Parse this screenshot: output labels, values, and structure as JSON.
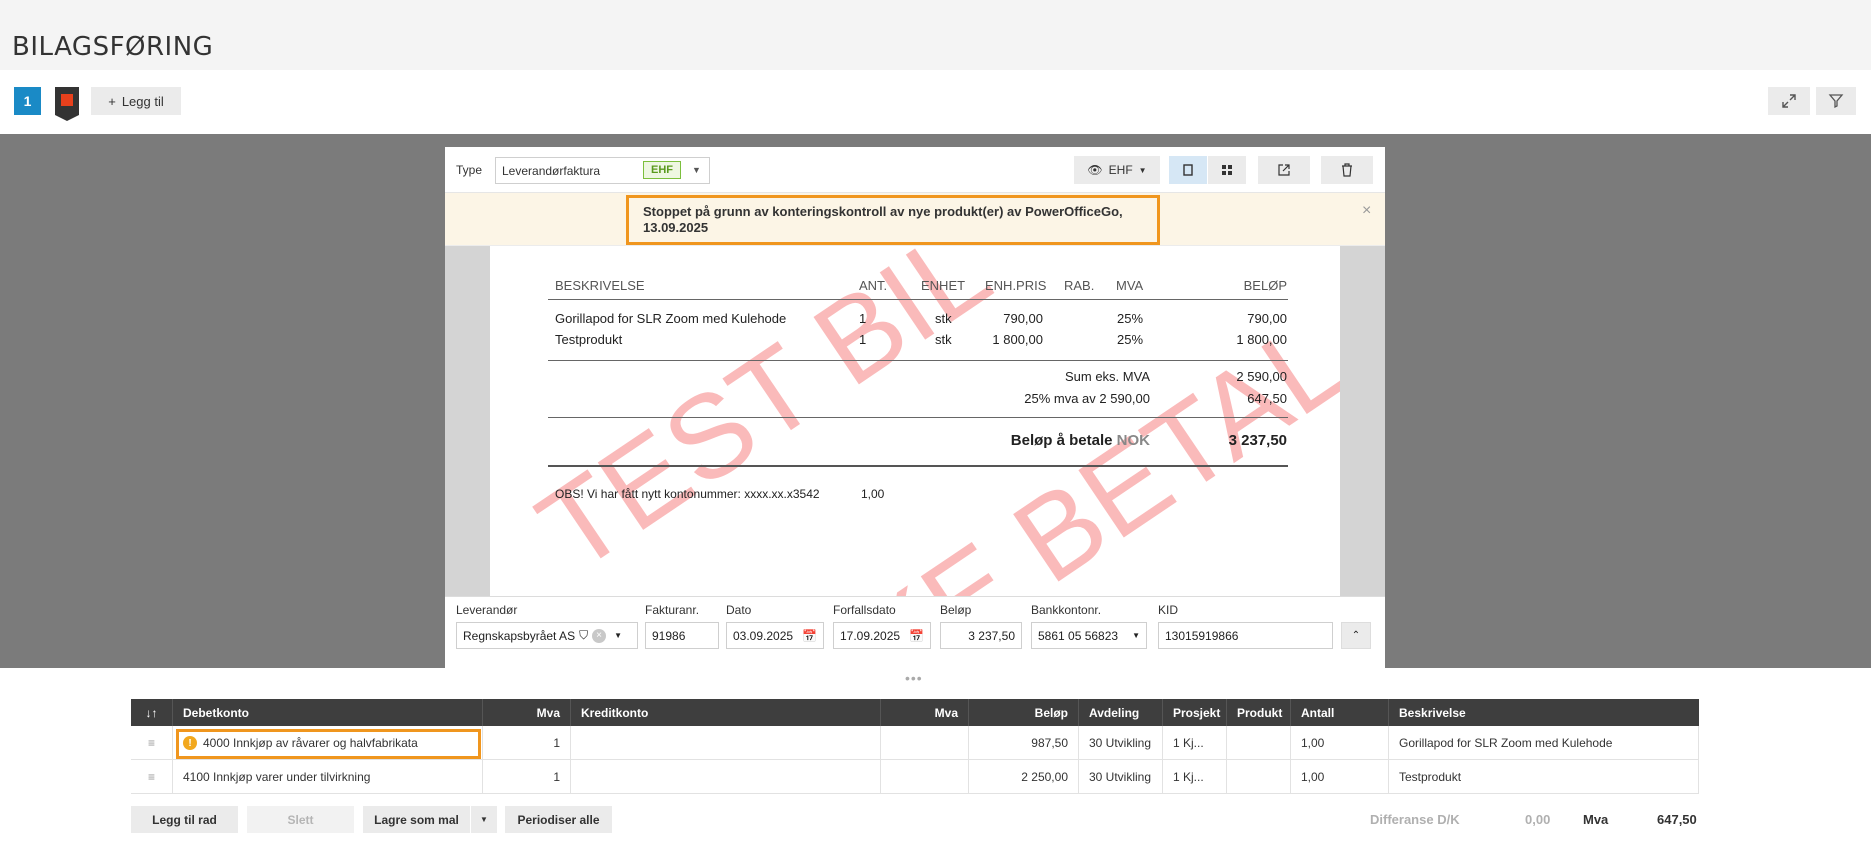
{
  "page": {
    "title": "BILAGSFØRING"
  },
  "toolbar": {
    "tab_number": "1",
    "add_label": "Legg til"
  },
  "document": {
    "type_label": "Type",
    "type_value": "Leverandørfaktura",
    "format_badge": "EHF",
    "view_format": "EHF",
    "notice": "Stoppet på grunn av konteringskontroll av nye produkt(er) av PowerOfficeGo, 13.09.2025",
    "notice_close": "×",
    "watermark_1": "TEST BIL",
    "watermark_2": "IKKE BETAL"
  },
  "invoice": {
    "headers": {
      "desc": "BESKRIVELSE",
      "qty": "ANT.",
      "unit": "ENHET",
      "price": "ENH.PRIS",
      "disc": "RAB.",
      "vat": "MVA",
      "amount": "BELØP"
    },
    "lines": [
      {
        "desc": "Gorillapod for SLR Zoom med Kulehode",
        "qty": "1",
        "unit": "stk",
        "price": "790,00",
        "vat": "25%",
        "amount": "790,00"
      },
      {
        "desc": "Testprodukt",
        "qty": "1",
        "unit": "stk",
        "price": "1 800,00",
        "vat": "25%",
        "amount": "1 800,00"
      }
    ],
    "sum_label": "Sum eks. MVA",
    "sum_value": "2 590,00",
    "vat_label": "25% mva av 2 590,00",
    "vat_value": "647,50",
    "total_label": "Beløp å betale",
    "total_currency": "NOK",
    "total_value": "3 237,50",
    "obs_text": "OBS! Vi har fått nytt kontonummer: xxxx.xx.x3542",
    "obs_value": "1,00"
  },
  "fields": {
    "supplier_label": "Leverandør",
    "supplier_value": "Regnskapsbyrået AS",
    "invoice_no_label": "Fakturanr.",
    "invoice_no_value": "91986",
    "date_label": "Dato",
    "date_value": "03.09.2025",
    "due_label": "Forfallsdato",
    "due_value": "17.09.2025",
    "amount_label": "Beløp",
    "amount_value": "3 237,50",
    "bank_label": "Bankkontonr.",
    "bank_value": "5861 05 56823",
    "kid_label": "KID",
    "kid_value": "13015919866"
  },
  "grid": {
    "headers": {
      "sort": "↓↑",
      "debit": "Debetkonto",
      "mva1": "Mva",
      "credit": "Kreditkonto",
      "mva2": "Mva",
      "amount": "Beløp",
      "dept": "Avdeling",
      "project": "Prosjekt",
      "product": "Produkt",
      "qty": "Antall",
      "desc": "Beskrivelse"
    },
    "rows": [
      {
        "debit": "4000 Innkjøp av råvarer og halvfabrikata",
        "mva1": "1",
        "credit": "",
        "mva2": "",
        "amount": "987,50",
        "dept": "30 Utvikling",
        "project": "1 Kj...",
        "product": "",
        "qty": "1,00",
        "desc": "Gorillapod for SLR Zoom med Kulehode"
      },
      {
        "debit": "4100 Innkjøp varer under tilvirkning",
        "mva1": "1",
        "credit": "",
        "mva2": "",
        "amount": "2 250,00",
        "dept": "30 Utvikling",
        "project": "1 Kj...",
        "product": "",
        "qty": "1,00",
        "desc": "Testprodukt"
      }
    ]
  },
  "footer": {
    "add_row": "Legg til rad",
    "delete": "Slett",
    "save_template": "Lagre som mal",
    "periodize": "Periodiser alle",
    "diff_label": "Differanse D/K",
    "diff_value": "0,00",
    "mva_label": "Mva",
    "mva_value": "647,50"
  },
  "colors": {
    "accent": "#1a8ac6",
    "highlight": "#f0961e",
    "watermark": "#f45a5a",
    "header_dark": "#3e3e3e"
  }
}
